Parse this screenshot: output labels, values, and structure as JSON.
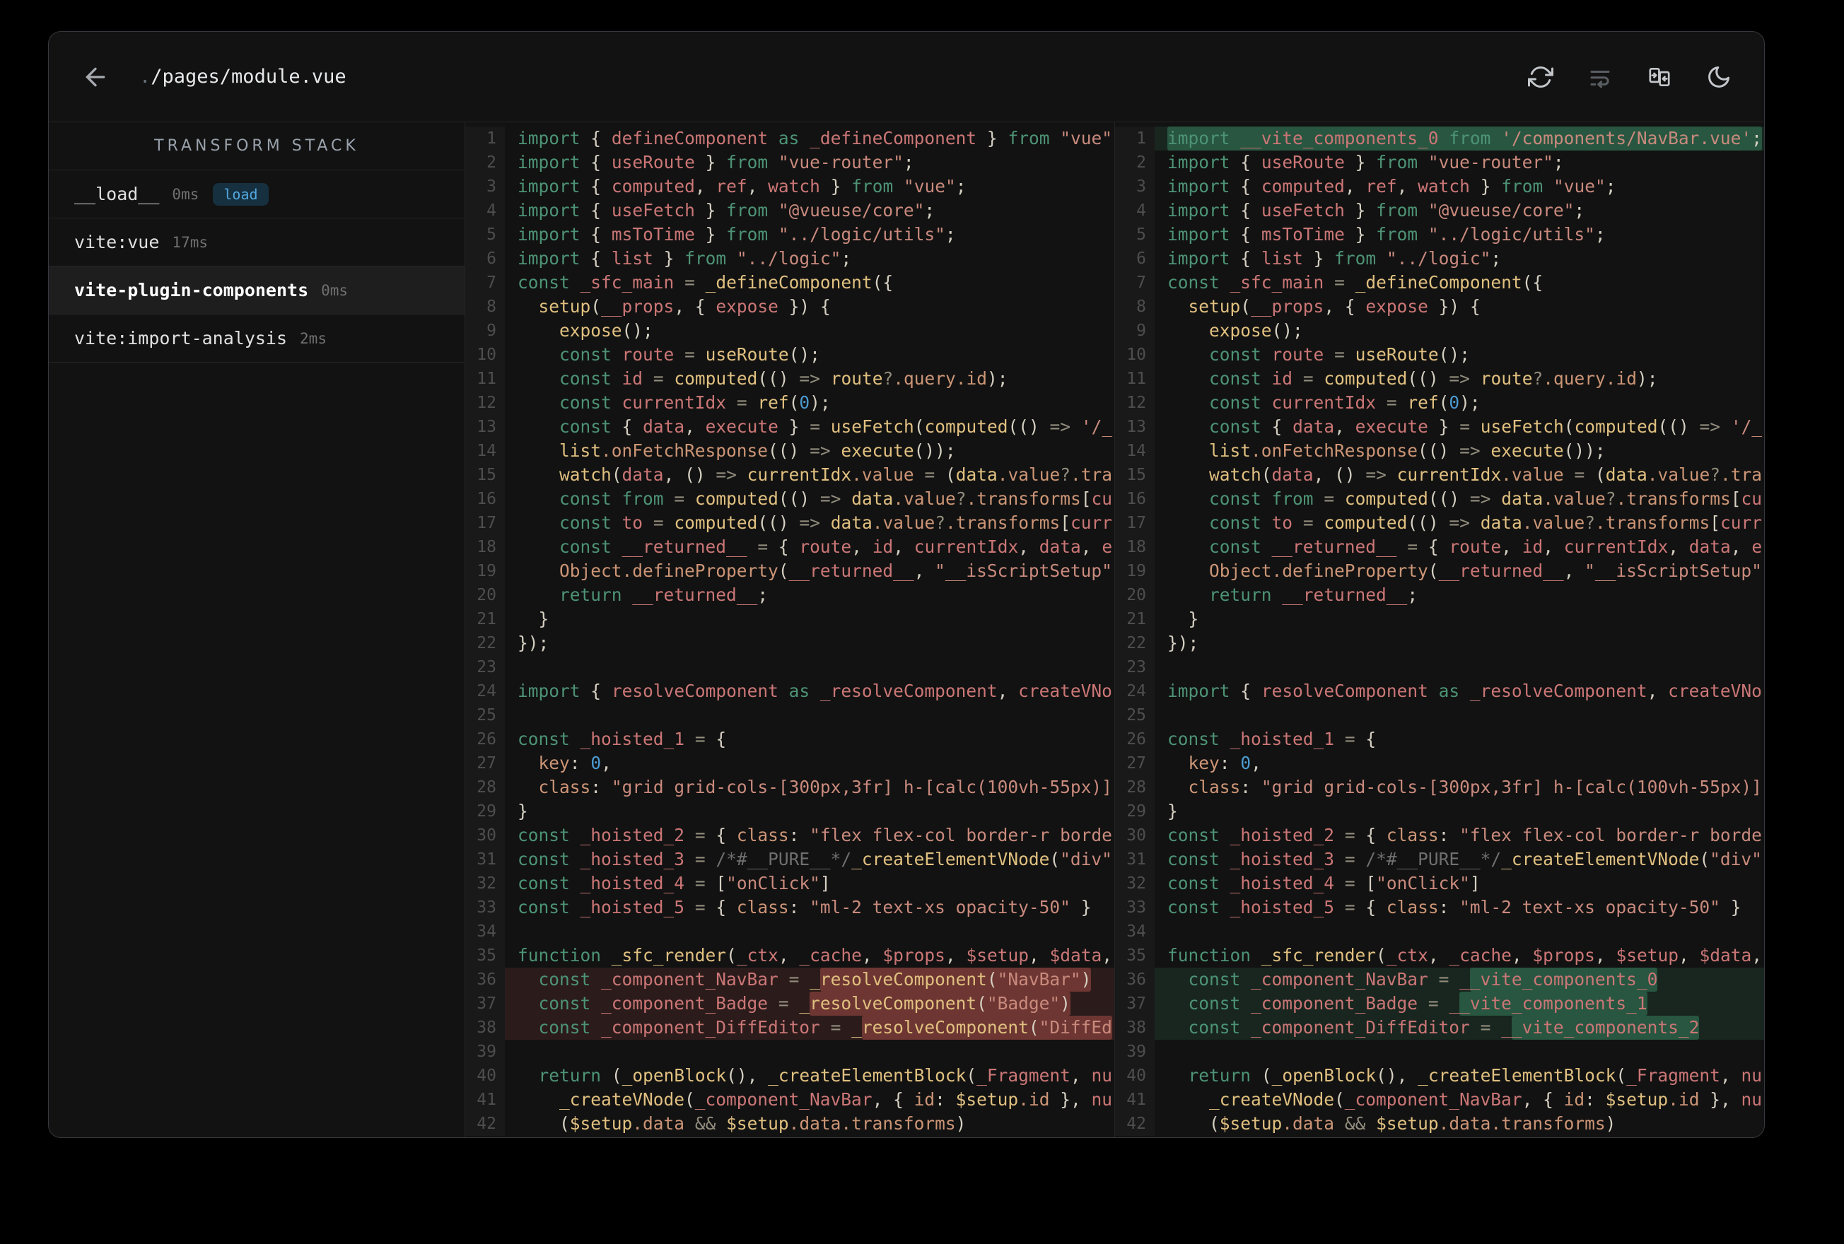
{
  "window": {
    "title_dot": ".",
    "title_path": "/pages/module.vue"
  },
  "toolbar": {
    "icons": [
      "back-arrow",
      "refresh",
      "text-wrap",
      "merge-panels",
      "dark-mode-moon"
    ]
  },
  "sidebar": {
    "header": "TRANSFORM STACK",
    "items": [
      {
        "name": "__load__",
        "time": "0ms",
        "badge": "load",
        "selected": false
      },
      {
        "name": "vite:vue",
        "time": "17ms",
        "badge": "",
        "selected": false
      },
      {
        "name": "vite-plugin-components",
        "time": "0ms",
        "badge": "",
        "selected": true
      },
      {
        "name": "vite:import-analysis",
        "time": "2ms",
        "badge": "",
        "selected": false
      }
    ]
  },
  "theme": {
    "page_bg": "#000000",
    "card_bg": "#121212",
    "card_border": "#35383c",
    "border": "#242427",
    "gutter_bg": "#191919",
    "line_number": "#4e4e4e",
    "kw": "#4d9375",
    "idc": "#cb7676",
    "fn": "#e0c080",
    "str": "#c98a7d",
    "prop": "#cc9576",
    "num": "#4c9bd1",
    "cmt": "#6f6f6f",
    "pun": "#d5cfc2",
    "op": "#938d7e",
    "rem_line": "rgba(201,90,84,0.14)",
    "rem_word": "rgba(201,90,84,0.42)",
    "add_line": "rgba(64,160,116,0.14)",
    "add_word": "rgba(64,160,116,0.40)",
    "badge_bg": "#16303f",
    "badge_text": "#52a8e0"
  },
  "code": {
    "left": [
      {
        "n": 1,
        "t": "import { defineComponent as _defineComponent } from \"vue\""
      },
      {
        "n": 2,
        "t": "import { useRoute } from \"vue-router\";"
      },
      {
        "n": 3,
        "t": "import { computed, ref, watch } from \"vue\";"
      },
      {
        "n": 4,
        "t": "import { useFetch } from \"@vueuse/core\";"
      },
      {
        "n": 5,
        "t": "import { msToTime } from \"../logic/utils\";"
      },
      {
        "n": 6,
        "t": "import { list } from \"../logic\";"
      },
      {
        "n": 7,
        "t": "const _sfc_main = _defineComponent({"
      },
      {
        "n": 8,
        "t": "  setup(__props, { expose }) {"
      },
      {
        "n": 9,
        "t": "    expose();"
      },
      {
        "n": 10,
        "t": "    const route = useRoute();"
      },
      {
        "n": 11,
        "t": "    const id = computed(() => route?.query.id);"
      },
      {
        "n": 12,
        "t": "    const currentIdx = ref(0);"
      },
      {
        "n": 13,
        "t": "    const { data, execute } = useFetch(computed(() => '/_"
      },
      {
        "n": 14,
        "t": "    list.onFetchResponse(() => execute());"
      },
      {
        "n": 15,
        "t": "    watch(data, () => currentIdx.value = (data.value?.tra"
      },
      {
        "n": 16,
        "t": "    const from = computed(() => data.value?.transforms[cu"
      },
      {
        "n": 17,
        "t": "    const to = computed(() => data.value?.transforms[curr"
      },
      {
        "n": 18,
        "t": "    const __returned__ = { route, id, currentIdx, data, e"
      },
      {
        "n": 19,
        "t": "    Object.defineProperty(__returned__, \"__isScriptSetup\""
      },
      {
        "n": 20,
        "t": "    return __returned__;"
      },
      {
        "n": 21,
        "t": "  }"
      },
      {
        "n": 22,
        "t": "});"
      },
      {
        "n": 23,
        "t": ""
      },
      {
        "n": 24,
        "t": "import { resolveComponent as _resolveComponent, createVNo"
      },
      {
        "n": 25,
        "t": ""
      },
      {
        "n": 26,
        "t": "const _hoisted_1 = {"
      },
      {
        "n": 27,
        "t": "  key: 0,"
      },
      {
        "n": 28,
        "t": "  class: \"grid grid-cols-[300px,3fr] h-[calc(100vh-55px)]"
      },
      {
        "n": 29,
        "t": "}"
      },
      {
        "n": 30,
        "t": "const _hoisted_2 = { class: \"flex flex-col border-r borde"
      },
      {
        "n": 31,
        "t": "const _hoisted_3 = /*#__PURE__*/_createElementVNode(\"div\""
      },
      {
        "n": 32,
        "t": "const _hoisted_4 = [\"onClick\"]"
      },
      {
        "n": 33,
        "t": "const _hoisted_5 = { class: \"ml-2 text-xs opacity-50\" }"
      },
      {
        "n": 34,
        "t": ""
      },
      {
        "n": 35,
        "t": "function _sfc_render(_ctx, _cache, $props, $setup, $data,"
      },
      {
        "n": 36,
        "t": "  const _component_NavBar = _resolveComponent(\"NavBar\")",
        "d": "rem",
        "hs": 29,
        "he": 55
      },
      {
        "n": 37,
        "t": "  const _component_Badge = _resolveComponent(\"Badge\")",
        "d": "rem",
        "hs": 28,
        "he": 53
      },
      {
        "n": 38,
        "t": "  const _component_DiffEditor = _resolveComponent(\"DiffEd",
        "d": "rem",
        "hs": 33,
        "he": 57
      },
      {
        "n": 39,
        "t": ""
      },
      {
        "n": 40,
        "t": "  return (_openBlock(), _createElementBlock(_Fragment, nu"
      },
      {
        "n": 41,
        "t": "    _createVNode(_component_NavBar, { id: $setup.id }, nu"
      },
      {
        "n": 42,
        "t": "    ($setup.data && $setup.data.transforms)"
      }
    ],
    "right": [
      {
        "n": 1,
        "t": "import __vite_components_0 from '/components/NavBar.vue';",
        "d": "add",
        "hs": 0,
        "he": 57
      },
      {
        "n": 2,
        "t": "import { useRoute } from \"vue-router\";"
      },
      {
        "n": 3,
        "t": "import { computed, ref, watch } from \"vue\";"
      },
      {
        "n": 4,
        "t": "import { useFetch } from \"@vueuse/core\";"
      },
      {
        "n": 5,
        "t": "import { msToTime } from \"../logic/utils\";"
      },
      {
        "n": 6,
        "t": "import { list } from \"../logic\";"
      },
      {
        "n": 7,
        "t": "const _sfc_main = _defineComponent({"
      },
      {
        "n": 8,
        "t": "  setup(__props, { expose }) {"
      },
      {
        "n": 9,
        "t": "    expose();"
      },
      {
        "n": 10,
        "t": "    const route = useRoute();"
      },
      {
        "n": 11,
        "t": "    const id = computed(() => route?.query.id);"
      },
      {
        "n": 12,
        "t": "    const currentIdx = ref(0);"
      },
      {
        "n": 13,
        "t": "    const { data, execute } = useFetch(computed(() => '/_"
      },
      {
        "n": 14,
        "t": "    list.onFetchResponse(() => execute());"
      },
      {
        "n": 15,
        "t": "    watch(data, () => currentIdx.value = (data.value?.tra"
      },
      {
        "n": 16,
        "t": "    const from = computed(() => data.value?.transforms[cu"
      },
      {
        "n": 17,
        "t": "    const to = computed(() => data.value?.transforms[curr"
      },
      {
        "n": 18,
        "t": "    const __returned__ = { route, id, currentIdx, data, e"
      },
      {
        "n": 19,
        "t": "    Object.defineProperty(__returned__, \"__isScriptSetup\""
      },
      {
        "n": 20,
        "t": "    return __returned__;"
      },
      {
        "n": 21,
        "t": "  }"
      },
      {
        "n": 22,
        "t": "});"
      },
      {
        "n": 23,
        "t": ""
      },
      {
        "n": 24,
        "t": "import { resolveComponent as _resolveComponent, createVNo"
      },
      {
        "n": 25,
        "t": ""
      },
      {
        "n": 26,
        "t": "const _hoisted_1 = {"
      },
      {
        "n": 27,
        "t": "  key: 0,"
      },
      {
        "n": 28,
        "t": "  class: \"grid grid-cols-[300px,3fr] h-[calc(100vh-55px)]"
      },
      {
        "n": 29,
        "t": "}"
      },
      {
        "n": 30,
        "t": "const _hoisted_2 = { class: \"flex flex-col border-r borde"
      },
      {
        "n": 31,
        "t": "const _hoisted_3 = /*#__PURE__*/_createElementVNode(\"div\""
      },
      {
        "n": 32,
        "t": "const _hoisted_4 = [\"onClick\"]"
      },
      {
        "n": 33,
        "t": "const _hoisted_5 = { class: \"ml-2 text-xs opacity-50\" }"
      },
      {
        "n": 34,
        "t": ""
      },
      {
        "n": 35,
        "t": "function _sfc_render(_ctx, _cache, $props, $setup, $data,"
      },
      {
        "n": 36,
        "t": "  const _component_NavBar = __vite_components_0",
        "d": "add",
        "hs": 29,
        "he": 47
      },
      {
        "n": 37,
        "t": "  const _component_Badge = __vite_components_1",
        "d": "add",
        "hs": 28,
        "he": 46
      },
      {
        "n": 38,
        "t": "  const _component_DiffEditor = __vite_components_2",
        "d": "add",
        "hs": 33,
        "he": 51
      },
      {
        "n": 39,
        "t": ""
      },
      {
        "n": 40,
        "t": "  return (_openBlock(), _createElementBlock(_Fragment, nu"
      },
      {
        "n": 41,
        "t": "    _createVNode(_component_NavBar, { id: $setup.id }, nu"
      },
      {
        "n": 42,
        "t": "    ($setup.data && $setup.data.transforms)"
      }
    ]
  }
}
